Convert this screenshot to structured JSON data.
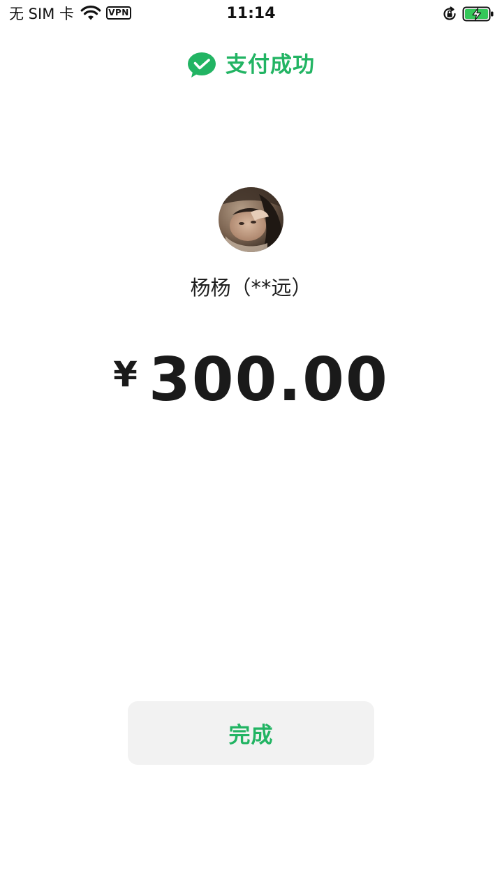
{
  "status_bar": {
    "carrier": "无 SIM 卡",
    "vpn_label": "VPN",
    "time": "11:14",
    "icons": [
      "wifi-icon",
      "rotation-lock-icon",
      "battery-charging-icon"
    ]
  },
  "header": {
    "icon": "wechat-pay-icon",
    "title": "支付成功"
  },
  "payee": {
    "avatar": "avatar-photo",
    "name": "杨杨（**远）"
  },
  "payment": {
    "currency_symbol": "¥",
    "amount": "300.00"
  },
  "actions": {
    "done_label": "完成"
  },
  "colors": {
    "accent": "#22b463",
    "button_bg": "#f2f2f2",
    "text": "#1a1a1a",
    "battery_fill": "#34c759"
  }
}
